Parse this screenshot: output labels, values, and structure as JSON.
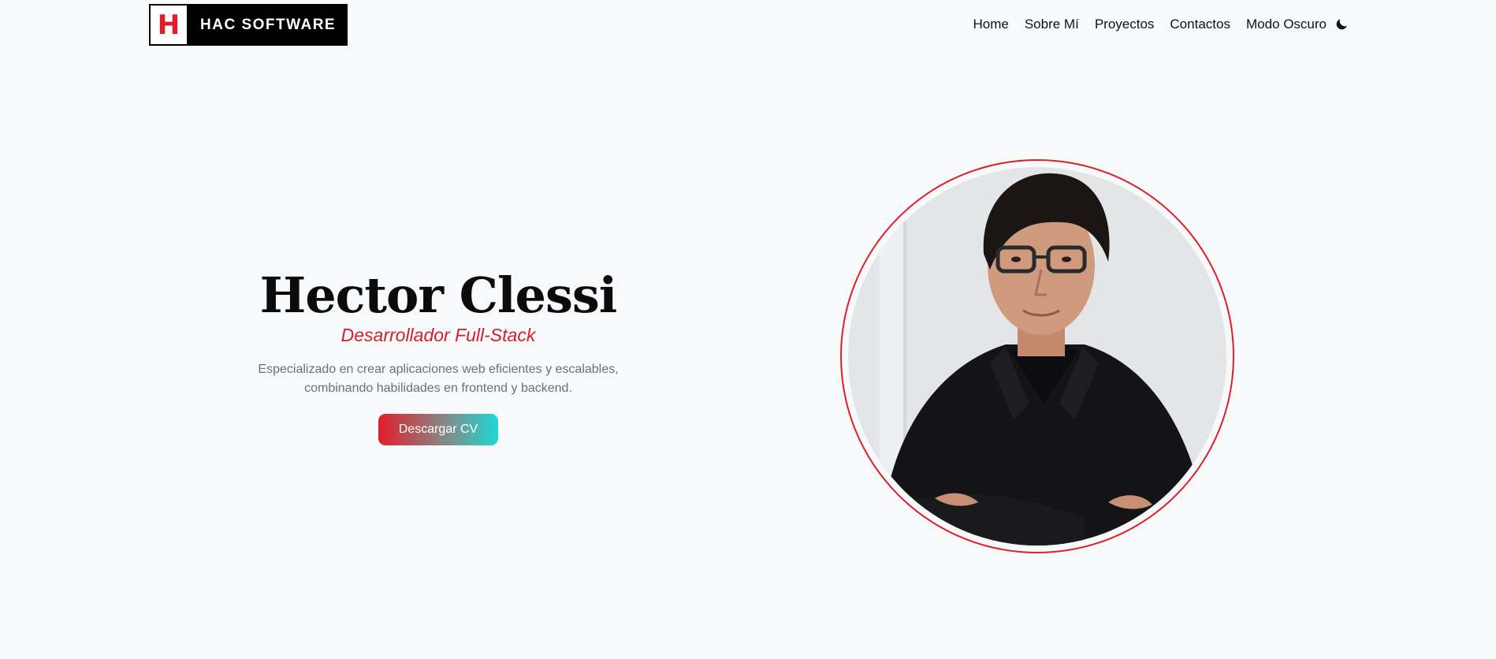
{
  "brand": {
    "mark": "H",
    "name": "HAC SOFTWARE",
    "accent_color": "#e11d2a"
  },
  "nav": {
    "items": [
      {
        "label": "Home"
      },
      {
        "label": "Sobre Mí"
      },
      {
        "label": "Proyectos"
      },
      {
        "label": "Contactos"
      }
    ],
    "dark_mode_label": "Modo Oscuro",
    "dark_mode_icon": "moon-icon"
  },
  "hero": {
    "name": "Hector Clessi",
    "role": "Desarrollador Full-Stack",
    "description": "Especializado en crear aplicaciones web eficientes y escalables, combinando habilidades en frontend y backend.",
    "cta_label": "Descargar CV",
    "cta_gradient": [
      "#e11d2a",
      "#1fd8d3"
    ]
  },
  "portrait": {
    "ring_color": "#e11d2a"
  }
}
